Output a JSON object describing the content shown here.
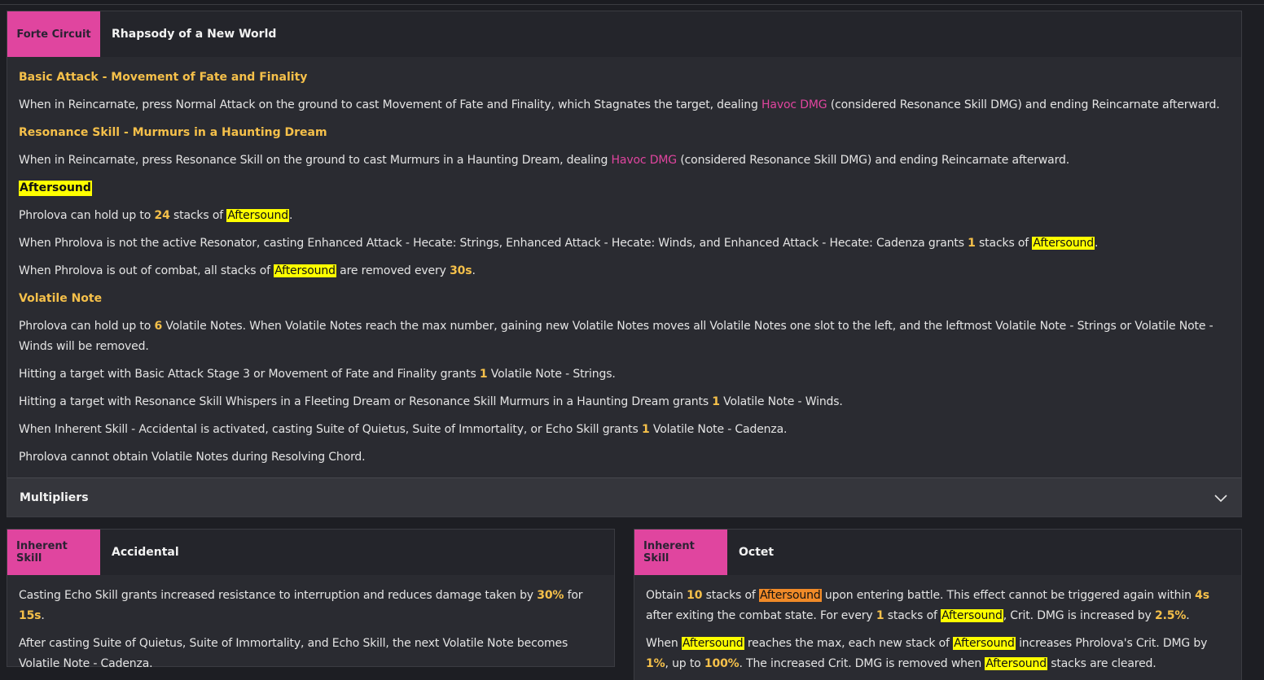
{
  "forte": {
    "tag": "Forte Circuit",
    "title": "Rhapsody of a New World",
    "basic_title": "Basic Attack - Movement of Fate and Finality",
    "basic_text": [
      "When in Reincarnate, press Normal Attack on the ground to cast Movement of Fate and Finality, which Stagnates the target, dealing ",
      "Havoc DMG",
      " (considered Resonance Skill DMG) and ending Reincarnate afterward."
    ],
    "res_title": "Resonance Skill - Murmurs in a Haunting Dream",
    "res_text": [
      "When in Reincarnate, press Resonance Skill on the ground to cast Murmurs in a Haunting Dream, dealing ",
      "Havoc DMG",
      " (considered Resonance Skill DMG) and ending Reincarnate afterward."
    ],
    "aftersound_title": "Aftersound",
    "aftersound_1": [
      "Phrolova can hold up to ",
      "24",
      " stacks of ",
      "Aftersound",
      "."
    ],
    "aftersound_2": [
      "When Phrolova is not the active Resonator, casting Enhanced Attack - Hecate: Strings, Enhanced Attack - Hecate: Winds, and Enhanced Attack - Hecate: Cadenza grants ",
      "1",
      " stacks of ",
      "Aftersound",
      "."
    ],
    "aftersound_3": [
      "When Phrolova is out of combat, all stacks of ",
      "Aftersound",
      " are removed every ",
      "30s",
      "."
    ],
    "volatile_title": "Volatile Note",
    "volatile_1": [
      "Phrolova can hold up to ",
      "6",
      " Volatile Notes. When Volatile Notes reach the max number, gaining new Volatile Notes moves all Volatile Notes one slot to the left, and the leftmost Volatile Note - Strings or Volatile Note - Winds will be removed."
    ],
    "volatile_2": [
      "Hitting a target with Basic Attack Stage 3 or Movement of Fate and Finality grants ",
      "1",
      " Volatile Note - Strings."
    ],
    "volatile_3": [
      "Hitting a target with Resonance Skill Whispers in a Fleeting Dream or Resonance Skill Murmurs in a Haunting Dream grants ",
      "1",
      " Volatile Note - Winds."
    ],
    "volatile_4": [
      "When Inherent Skill - Accidental is activated, casting Suite of Quietus, Suite of Immortality, or Echo Skill grants ",
      "1",
      " Volatile Note - Cadenza."
    ],
    "volatile_5": "Phrolova cannot obtain Volatile Notes during Resolving Chord.",
    "multipliers_label": "Multipliers"
  },
  "accidental": {
    "tag": "Inherent Skill",
    "title": "Accidental",
    "p1": [
      "Casting Echo Skill grants increased resistance to interruption and reduces damage taken by ",
      "30%",
      " for ",
      "15s",
      "."
    ],
    "p2": "After casting Suite of Quietus, Suite of Immortality, and Echo Skill, the next Volatile Note becomes Volatile Note - Cadenza."
  },
  "octet": {
    "tag": "Inherent Skill",
    "title": "Octet",
    "p1": [
      "Obtain ",
      "10",
      " stacks of ",
      "Aftersound",
      " upon entering battle. This effect cannot be triggered again within ",
      "4s",
      " after exiting the combat state. For every ",
      "1",
      " stacks of ",
      "Aftersound",
      ", Crit. DMG is increased by ",
      "2.5%",
      "."
    ],
    "p2": [
      "When ",
      "Aftersound",
      " reaches the max, each new stack of ",
      "Aftersound",
      " increases Phrolova's Crit. DMG by ",
      "1%",
      ", up to ",
      "100%",
      ". The increased Crit. DMG is removed when ",
      "Aftersound",
      " stacks are cleared."
    ]
  },
  "icons": {
    "expand": "chevron-down-icon"
  },
  "colors": {
    "tag": "#e0459f",
    "number": "#f5c04a",
    "highlight": "#ffff00",
    "highlight_alt": "#f08a28",
    "havoc": "#e0459f"
  }
}
